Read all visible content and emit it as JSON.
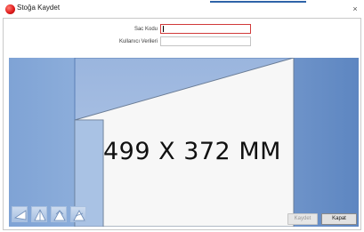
{
  "window": {
    "title": "Stoğa Kaydet",
    "close_glyph": "×"
  },
  "form": {
    "sac_kodu_label": "Sac Kodu",
    "sac_kodu_value": "",
    "kullanici_verileri_label": "Kullanıcı Verileri",
    "kullanici_verileri_value": ""
  },
  "preview": {
    "dimension_text": "499 X 372 MM",
    "background_color": "#8fb0dc",
    "sheet_color": "#f7f7f7"
  },
  "toolbar": {
    "tools": [
      {
        "icon": "triangle-left-icon"
      },
      {
        "icon": "triangle-up-icon"
      },
      {
        "icon": "triangle-bend-icon"
      },
      {
        "icon": "triangle-cut-icon"
      }
    ]
  },
  "buttons": {
    "save_label": "Kaydet",
    "close_label": "Kapat"
  }
}
